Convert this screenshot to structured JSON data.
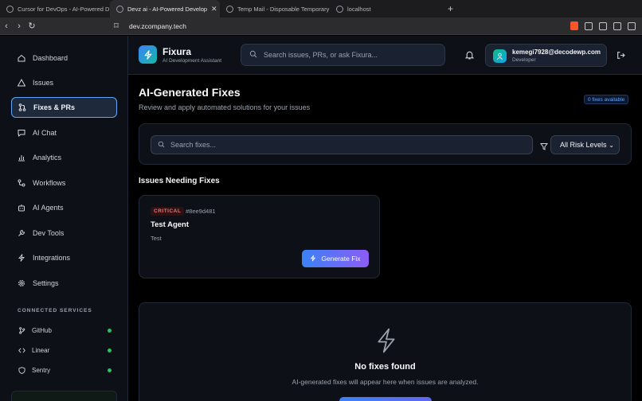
{
  "browser": {
    "tabs": [
      {
        "label": "Cursor for DevOps - AI-Powered D",
        "active": false
      },
      {
        "label": "Devz ai - AI-Powered Develop",
        "active": true
      },
      {
        "label": "Temp Mail - Disposable Temporary",
        "active": false
      },
      {
        "label": "localhost",
        "active": false
      }
    ],
    "url": "dev.zcompany.tech"
  },
  "sidebar": {
    "items": [
      {
        "label": "Dashboard",
        "icon": "home-icon"
      },
      {
        "label": "Issues",
        "icon": "warning-icon"
      },
      {
        "label": "Fixes & PRs",
        "icon": "pull-request-icon",
        "active": true
      },
      {
        "label": "AI Chat",
        "icon": "chat-icon"
      },
      {
        "label": "Analytics",
        "icon": "bar-chart-icon"
      },
      {
        "label": "Workflows",
        "icon": "workflow-icon"
      },
      {
        "label": "AI Agents",
        "icon": "robot-icon"
      },
      {
        "label": "Dev Tools",
        "icon": "wrench-icon"
      },
      {
        "label": "Integrations",
        "icon": "bolt-icon"
      },
      {
        "label": "Settings",
        "icon": "gear-icon"
      }
    ],
    "connected_title": "CONNECTED SERVICES",
    "services": [
      {
        "label": "GitHub",
        "icon": "git-branch-icon",
        "status_color": "#22c55e"
      },
      {
        "label": "Linear",
        "icon": "code-icon",
        "status_color": "#22c55e"
      },
      {
        "label": "Sentry",
        "icon": "shield-icon",
        "status_color": "#22c55e"
      }
    ]
  },
  "header": {
    "brand": "Fixura",
    "brand_sub": "AI Development Assistant",
    "search_placeholder": "Search issues, PRs, or ask Fixura...",
    "user_email": "kemegi7928@decodewp.com",
    "user_role": "Developer"
  },
  "main": {
    "title": "AI-Generated Fixes",
    "subtitle": "Review and apply automated solutions for your issues",
    "badge": "0 fixes available",
    "filter_placeholder": "Search fixes...",
    "risk_select": "All Risk Levels",
    "section_title": "Issues Needing Fixes",
    "issue": {
      "severity": "CRITICAL",
      "hash": "#8ee9d481",
      "title": "Test Agent",
      "description": "Test",
      "button": "Generate Fix"
    },
    "empty": {
      "title": "No fixes found",
      "subtitle": "AI-generated fixes will appear here when issues are analyzed."
    }
  },
  "colors": {
    "accent": "#3b82f6",
    "active_border": "#60a5fa",
    "critical": "#f87171",
    "online": "#22c55e"
  }
}
